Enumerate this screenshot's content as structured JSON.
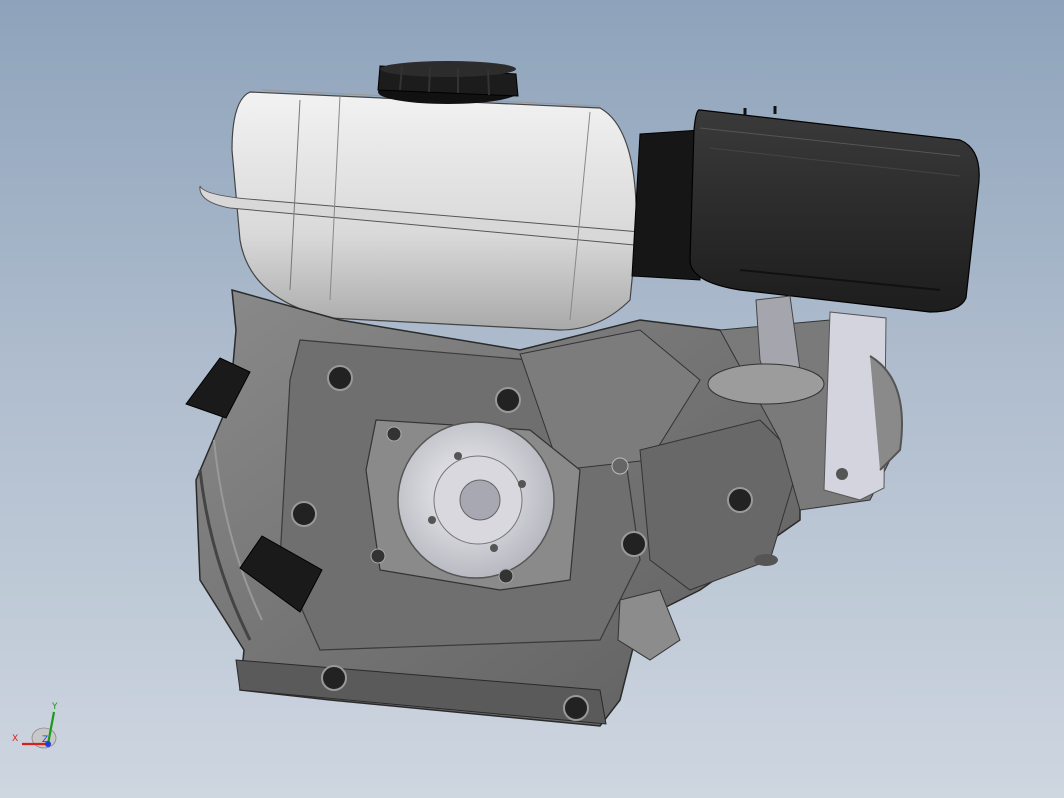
{
  "window": {
    "title": ""
  },
  "viewport": {
    "background_top": "#8ea3bb",
    "background_bottom": "#ced6e0",
    "model_description_icon": "small-engine-model"
  },
  "triad": {
    "x_label": "X",
    "y_label": "Y",
    "z_label": "Z",
    "x_color": "#d62020",
    "y_color": "#1a9a1a",
    "z_color": "#1f3fd8"
  }
}
